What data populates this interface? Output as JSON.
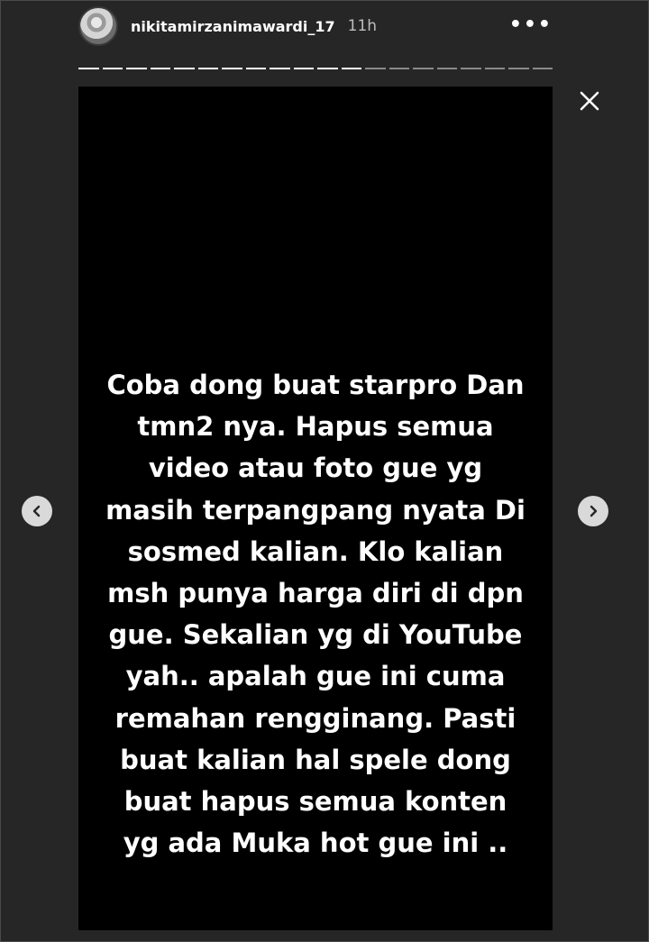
{
  "header": {
    "username": "nikitamirzanimawardi_17",
    "time": "11h",
    "more_icon": "more-horizontal-icon",
    "more_label": "•••"
  },
  "progress": {
    "segments": 20,
    "completed": 12
  },
  "story": {
    "text": "Coba dong buat starpro Dan\ntmn2 nya. Hapus semua\nvideo atau foto gue yg\nmasih terpangpang nyata Di\nsosmed kalian. Klo kalian\nmsh punya harga diri di dpn\ngue. Sekalian yg di YouTube\nyah.. apalah gue ini cuma\nremahan rengginang. Pasti\nbuat kalian hal spele dong\nbuat hapus semua konten\nyg ada Muka hot gue ini ..",
    "background": "#000000"
  },
  "controls": {
    "close_icon": "close-icon",
    "prev_icon": "chevron-left-icon",
    "next_icon": "chevron-right-icon"
  },
  "colors": {
    "page_bg": "#262626",
    "text": "#ffffff",
    "muted": "#bdbdbd",
    "nav_bg": "#d9d9d9"
  }
}
